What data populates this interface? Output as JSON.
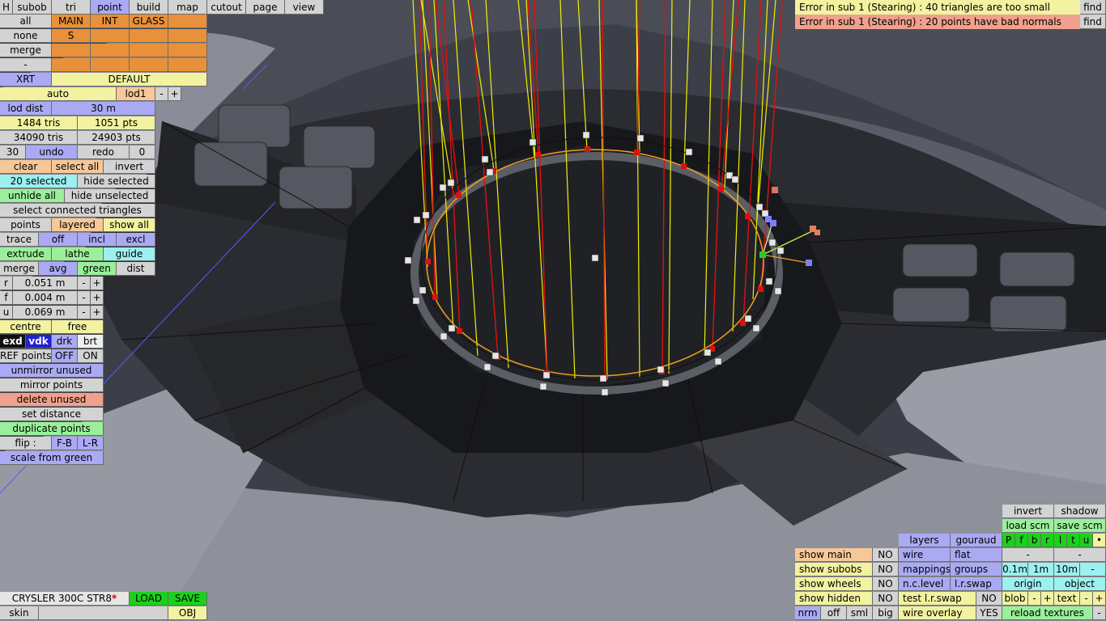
{
  "top_menu": [
    "H",
    "subob",
    "tri",
    "point",
    "build",
    "map",
    "cutout",
    "page",
    "view"
  ],
  "mat_row": [
    "all",
    "MAIN",
    "INT",
    "GLASS"
  ],
  "none_row": [
    "none",
    "S"
  ],
  "merge1": "merge",
  "dash1": "-",
  "xrt": "XRT",
  "default": "DEFAULT",
  "auto": "auto",
  "lod1": "lod1",
  "minus": "-",
  "plus": "+",
  "lod_dist": "lod dist",
  "lod_dist_val": "30 m",
  "tris1": "1484 tris",
  "pts1": "1051 pts",
  "tris2": "34090 tris",
  "pts2": "24903 pts",
  "n30": "30",
  "undo": "undo",
  "redo": "redo",
  "n0": "0",
  "clear": "clear",
  "select_all": "select all",
  "invert": "invert",
  "selected": "20 selected",
  "hide_selected": "hide selected",
  "unhide_all": "unhide all",
  "hide_unselected": "hide unselected",
  "select_connected": "select connected triangles",
  "points": "points",
  "layered": "layered",
  "show_all": "show all",
  "trace": "trace",
  "off": "off",
  "incl": "incl",
  "excl": "excl",
  "extrude": "extrude",
  "lathe": "lathe",
  "guide": "guide",
  "merge2": "merge",
  "avg": "avg",
  "green": "green",
  "dist": "dist",
  "r_lbl": "r",
  "r_val": "0.051 m",
  "f_lbl": "f",
  "f_val": "0.004 m",
  "u_lbl": "u",
  "u_val": "0.069 m",
  "centre": "centre",
  "free": "free",
  "exd": "exd",
  "vdk": "vdk",
  "drk": "drk",
  "brt": "brt",
  "ref_points": "REF points",
  "OFF": "OFF",
  "ON": "ON",
  "unmirror": "unmirror unused",
  "mirror": "mirror points",
  "delete_unused": "delete unused",
  "set_distance": "set distance",
  "duplicate": "duplicate points",
  "flip": "flip :",
  "fb": "F-B",
  "lr": "L-R",
  "scale_green": "scale from green",
  "car_name": "CRYSLER 300C STR8",
  "asterisk": "*",
  "load": "LOAD",
  "save": "SAVE",
  "skin": "skin",
  "obj": "OBJ",
  "errors": [
    {
      "text": "Error in sub 1 (Stearing) : 40 triangles are too small",
      "find": "find",
      "color": "#f2f2a0"
    },
    {
      "text": "Error in sub 1 (Stearing) : 20 points have bad normals",
      "find": "find",
      "color": "#f0a08c"
    }
  ],
  "br_invert": "invert",
  "br_shadow": "shadow",
  "load_scm": "load scm",
  "save_scm": "save scm",
  "layers": "layers",
  "gouraud": "gouraud",
  "pfbrltu": [
    "P",
    "f",
    "b",
    "r",
    "l",
    "t",
    "u",
    "•"
  ],
  "show_main": "show main",
  "NO": "NO",
  "wire": "wire",
  "flat": "flat",
  "show_subobs": "show subobs",
  "mappings": "mappings",
  "groups": "groups",
  "d01": "0.1m",
  "d1": "1m",
  "d10": "10m",
  "show_wheels": "show wheels",
  "nc_level": "n.c.level",
  "lr_swap": "l.r.swap",
  "origin": "origin",
  "object": "object",
  "show_hidden": "show hidden",
  "test_lr_swap": "test l.r.swap",
  "blob": "blob",
  "text": "text",
  "nrm": "nrm",
  "off2": "off",
  "sml": "sml",
  "big": "big",
  "wire_overlay": "wire overlay",
  "YES": "YES",
  "reload_textures": "reload textures",
  "colors": {
    "yellow_line": "#f0f000",
    "red_line": "#e01010",
    "selection": "#f0a020",
    "green_point": "#20d020"
  }
}
